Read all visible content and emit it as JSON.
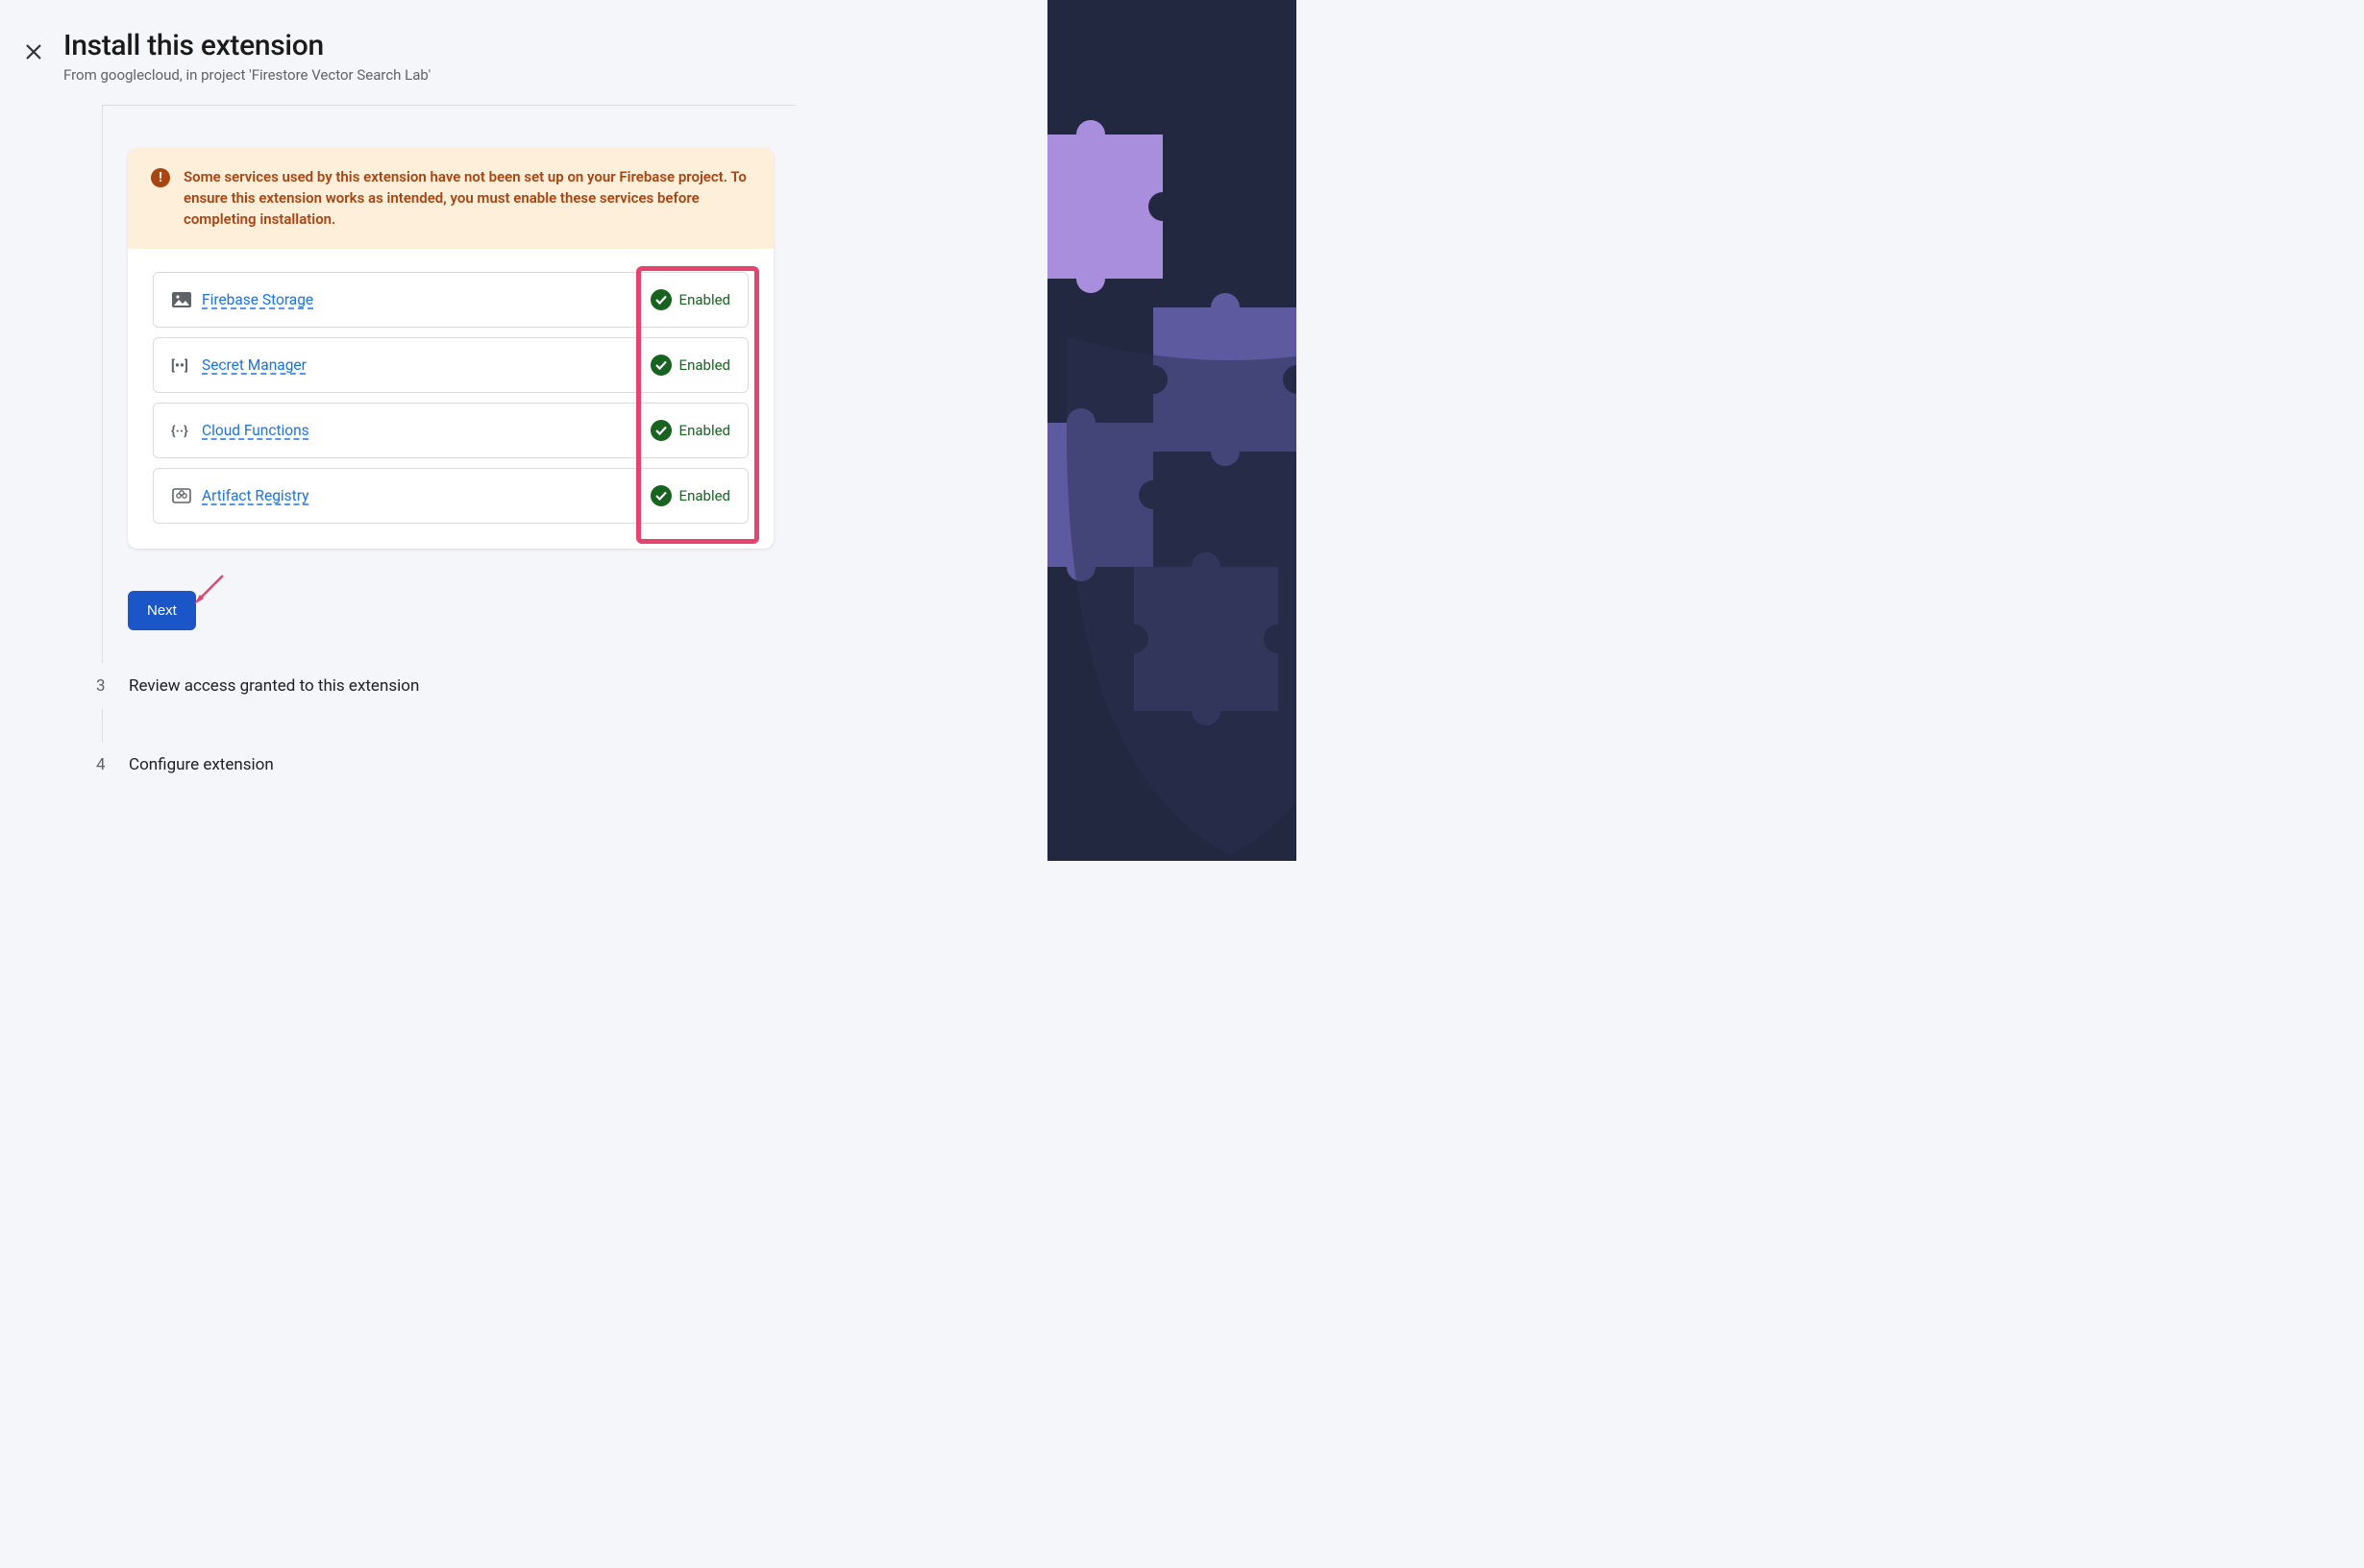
{
  "header": {
    "title": "Install this extension",
    "subtitle": "From googlecloud, in project 'Firestore Vector Search Lab'"
  },
  "alert": {
    "text": "Some services used by this extension have not been set up on your Firebase project. To ensure this extension works as intended, you must enable these services before completing installation."
  },
  "services": [
    {
      "name": "Firebase Storage",
      "status": "Enabled",
      "icon": "image-icon"
    },
    {
      "name": "Secret Manager",
      "status": "Enabled",
      "icon": "secret-icon"
    },
    {
      "name": "Cloud Functions",
      "status": "Enabled",
      "icon": "functions-icon"
    },
    {
      "name": "Artifact Registry",
      "status": "Enabled",
      "icon": "registry-icon"
    }
  ],
  "buttons": {
    "next": "Next"
  },
  "steps": {
    "step3": {
      "num": "3",
      "label": "Review access granted to this extension"
    },
    "step4": {
      "num": "4",
      "label": "Configure extension"
    }
  }
}
